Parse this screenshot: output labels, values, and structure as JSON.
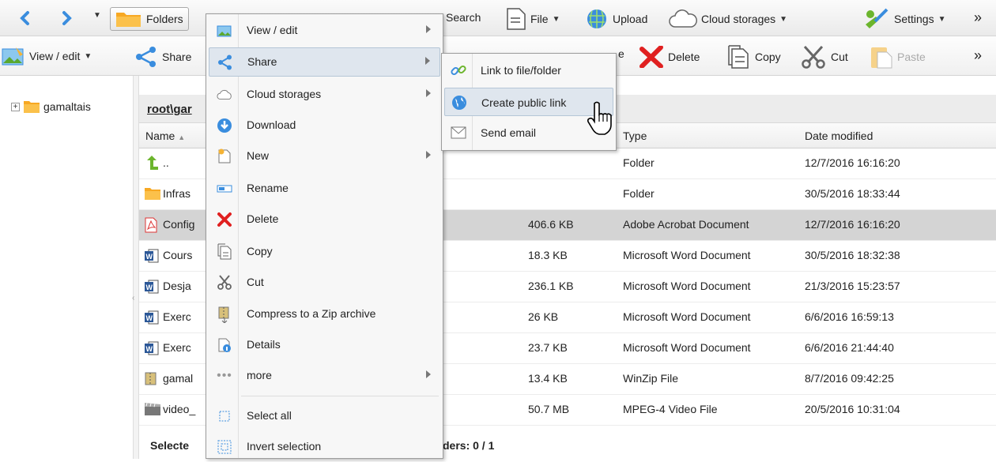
{
  "toolbar1": {
    "folders_label": "Folders",
    "search_label": "Search",
    "file_label": "File",
    "upload_label": "Upload",
    "cloud_label": "Cloud storages",
    "settings_label": "Settings",
    "more": "»"
  },
  "toolbar2": {
    "view_edit_label": "View / edit",
    "share_label": "Share",
    "delete_label": "Delete",
    "copy_label": "Copy",
    "cut_label": "Cut",
    "paste_label": "Paste",
    "more": "»"
  },
  "tree": {
    "root_label": "gamaltais"
  },
  "path": {
    "text": "root\\gar"
  },
  "columns": {
    "name": "Name",
    "type": "Type",
    "date": "Date modified"
  },
  "rows": [
    {
      "name": "..",
      "size": "",
      "type": "Folder",
      "date": "12/7/2016 16:16:20",
      "icon": "up-arrow-icon"
    },
    {
      "name": "Infras",
      "size": "",
      "type": "Folder",
      "date": "30/5/2016 18:33:44",
      "icon": "folder-icon"
    },
    {
      "name": "Config",
      "size": "406.6 KB",
      "type": "Adobe Acrobat Document",
      "date": "12/7/2016 16:16:20",
      "icon": "pdf-icon"
    },
    {
      "name": "Cours",
      "size": "18.3 KB",
      "type": "Microsoft Word Document",
      "date": "30/5/2016 18:32:38",
      "icon": "word-icon"
    },
    {
      "name": "Desja",
      "size": "236.1 KB",
      "type": "Microsoft Word Document",
      "date": "21/3/2016 15:23:57",
      "icon": "word-icon"
    },
    {
      "name": "Exerc",
      "size": "26 KB",
      "type": "Microsoft Word Document",
      "date": "6/6/2016 16:59:13",
      "icon": "word-icon"
    },
    {
      "name": "Exerc",
      "size": "23.7 KB",
      "type": "Microsoft Word Document",
      "date": "6/6/2016 21:44:40",
      "icon": "word-icon"
    },
    {
      "name": "gamal",
      "size": "13.4 KB",
      "type": "WinZip File",
      "date": "8/7/2016 09:42:25",
      "icon": "zip-icon"
    },
    {
      "name": "video_",
      "size": "50.7 MB",
      "type": "MPEG-4 Video File",
      "date": "20/5/2016 10:31:04",
      "icon": "video-icon"
    }
  ],
  "status": {
    "left": "Selecte",
    "right": "ders: 0 / 1"
  },
  "context_menu": {
    "items": [
      {
        "label": "View / edit"
      },
      {
        "label": "Share"
      },
      {
        "label": "Cloud storages"
      },
      {
        "label": "Download"
      },
      {
        "label": "New"
      },
      {
        "label": "Rename"
      },
      {
        "label": "Delete"
      },
      {
        "label": "Copy"
      },
      {
        "label": "Cut"
      },
      {
        "label": "Compress to a Zip archive"
      },
      {
        "label": "Details"
      },
      {
        "label": "more"
      },
      {
        "label": "Select all"
      },
      {
        "label": "Invert selection"
      }
    ]
  },
  "share_submenu": {
    "items": [
      {
        "label": "Link to file/folder"
      },
      {
        "label": "Create public link"
      },
      {
        "label": "Send email"
      }
    ]
  },
  "colors": {
    "accent_blue": "#3a8dde",
    "delete_red": "#e02020",
    "selection": "#d4d4d4",
    "folder_orange": "#f7a823"
  }
}
